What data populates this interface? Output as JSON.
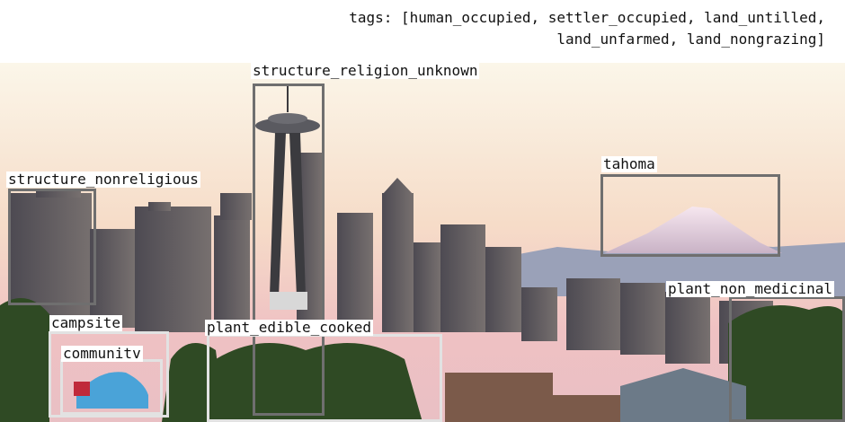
{
  "tags_text": "tags: [human_occupied, settler_occupied, land_untilled,\nland_unfarmed, land_nongrazing]",
  "labels": {
    "structure_religion_unknown": "structure_religion_unknown",
    "structure_nonreligious": "structure_nonreligious",
    "tahoma": "tahoma",
    "plant_non_medicinal": "plant_non_medicinal",
    "campsite": "campsite",
    "community": "communitv",
    "plant_edible_cooked": "plant_edible_cooked"
  },
  "colors": {
    "box_dark": "#6f6f6f",
    "box_light": "#e2e2e2",
    "sky_top": "#f8f3e6",
    "sky_bottom": "#f1c4bf"
  }
}
